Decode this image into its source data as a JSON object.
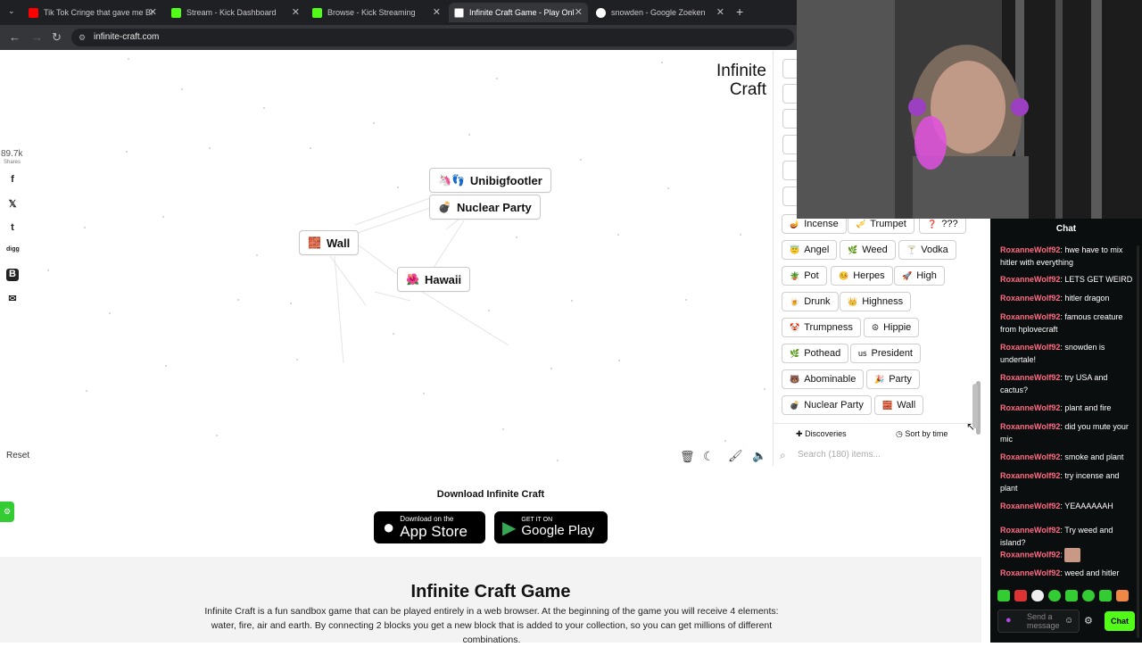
{
  "browser": {
    "tabs": [
      {
        "title": "Tik Tok Cringe that gave me Br",
        "icon": "youtube-icon",
        "color": "#ff0000"
      },
      {
        "title": "Stream - Kick Dashboard",
        "icon": "kick-icon",
        "color": "#53fc18"
      },
      {
        "title": "Browse - Kick Streaming",
        "icon": "kick-icon",
        "color": "#53fc18"
      },
      {
        "title": "Infinite Craft Game - Play Onlin",
        "icon": "infinite-craft-icon",
        "color": "#ffffff"
      },
      {
        "title": "snowden - Google Zoeken",
        "icon": "google-icon",
        "color": "#ffffff"
      }
    ],
    "new_tab": "+",
    "url": "infinite-craft.com"
  },
  "game": {
    "logo_line1": "Infinite",
    "logo_line2": "Craft",
    "shares_count": "89.7k",
    "shares_label": "Shares",
    "reset_label": "Reset",
    "canvas_elements": [
      {
        "name": "Unibigfootler",
        "emoji": "🦄👣"
      },
      {
        "name": "Nuclear Party",
        "emoji": "💣"
      },
      {
        "name": "Wall",
        "emoji": "🧱"
      },
      {
        "name": "Hawaii",
        "emoji": "🌺"
      }
    ]
  },
  "sidebar": {
    "items": [
      {
        "name": "Incense",
        "emoji": "🪔"
      },
      {
        "name": "Trumpet",
        "emoji": "🎺"
      },
      {
        "name": "???",
        "emoji": "❓"
      },
      {
        "name": "Angel",
        "emoji": "😇"
      },
      {
        "name": "Weed",
        "emoji": "🌿"
      },
      {
        "name": "Vodka",
        "emoji": "🍸"
      },
      {
        "name": "Pot",
        "emoji": "🪴"
      },
      {
        "name": "Herpes",
        "emoji": "🤒"
      },
      {
        "name": "High",
        "emoji": "🚀"
      },
      {
        "name": "Drunk",
        "emoji": "🍺"
      },
      {
        "name": "Highness",
        "emoji": "👑"
      },
      {
        "name": "Trumpness",
        "emoji": "🤡"
      },
      {
        "name": "Hippie",
        "emoji": "☮"
      },
      {
        "name": "Pothead",
        "emoji": "🌿"
      },
      {
        "name": "President",
        "emoji": "us"
      },
      {
        "name": "Abominable",
        "emoji": "🐻"
      },
      {
        "name": "Party",
        "emoji": "🎉"
      },
      {
        "name": "Nuclear Party",
        "emoji": "💣"
      },
      {
        "name": "Wall",
        "emoji": "🧱"
      }
    ],
    "tab_discoveries": "Discoveries",
    "tab_sort": "Sort by time",
    "search_placeholder": "Search (180) items..."
  },
  "page": {
    "download_title": "Download Infinite Craft",
    "appstore_small": "Download on the",
    "appstore_big": "App Store",
    "googleplay_small": "GET IT ON",
    "googleplay_big": "Google Play",
    "section_title": "Infinite Craft Game",
    "section_desc": "Infinite Craft is a fun sandbox game that can be played entirely in a web browser. At the beginning of the game you will receive 4 elements: water, fire, air and earth. By connecting 2 blocks you get a new block that is added to your collection, so you can get millions of different combinations."
  },
  "chat": {
    "header": "Chat",
    "messages": [
      {
        "user": "RoxanneWolf92",
        "text": "hwe have to mix hitler with everything"
      },
      {
        "user": "RoxanneWolf92",
        "text": "LETS GET WEIRD"
      },
      {
        "user": "RoxanneWolf92",
        "text": "hitler dragon"
      },
      {
        "user": "RoxanneWolf92",
        "text": "famous creature from hplovecraft"
      },
      {
        "user": "RoxanneWolf92",
        "text": "snowden is undertale!"
      },
      {
        "user": "RoxanneWolf92",
        "text": "try USA and cactus?"
      },
      {
        "user": "RoxanneWolf92",
        "text": "plant and fire"
      },
      {
        "user": "RoxanneWolf92",
        "text": "did you mute your mic"
      },
      {
        "user": "RoxanneWolf92",
        "text": "smoke and plant"
      },
      {
        "user": "RoxanneWolf92",
        "text": "try incense and plant"
      },
      {
        "user": "RoxanneWolf92",
        "text": "YEAAAAAAH"
      },
      {
        "user": "RoxanneWolf92",
        "text": "Try weed and island?"
      },
      {
        "user": "RoxanneWolf92",
        "text": ""
      },
      {
        "user": "RoxanneWolf92",
        "text": "weed and hitler"
      }
    ],
    "separator": ":",
    "input_placeholder": "Send a message",
    "send_label": "Chat",
    "accent": "#53fc18"
  }
}
